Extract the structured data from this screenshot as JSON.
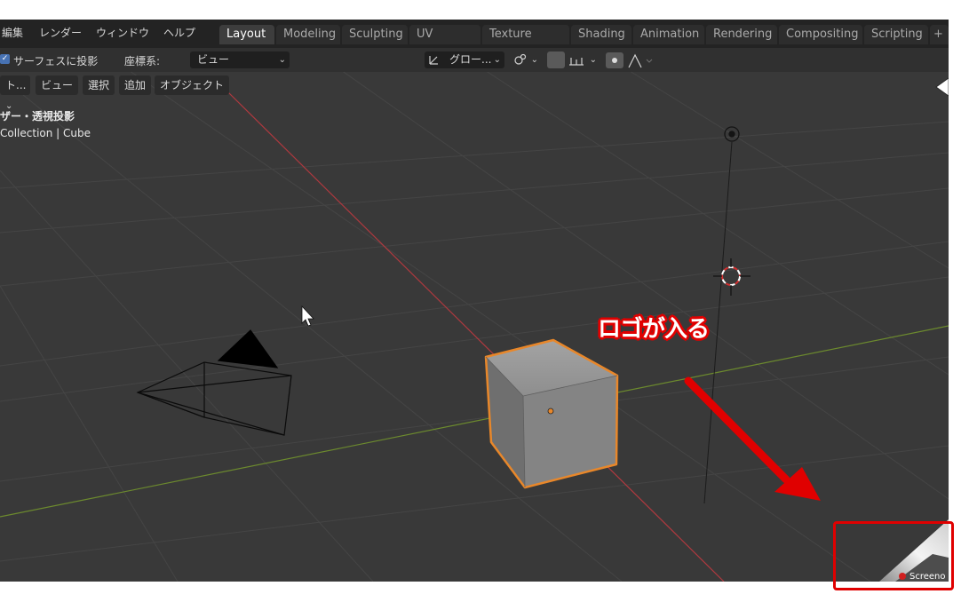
{
  "menu": {
    "edit": "編集",
    "render": "レンダー",
    "window": "ウィンドウ",
    "help": "ヘルプ"
  },
  "workspaces": [
    "Layout",
    "Modeling",
    "Sculpting",
    "UV Editing",
    "Texture Paint",
    "Shading",
    "Animation",
    "Rendering",
    "Compositing",
    "Scripting"
  ],
  "workspace_active": "Layout",
  "add_workspace": "+",
  "header": {
    "surface_project": "サーフェスに投影",
    "coordinate_label": "座標系:",
    "coordinate_value": "ビュー",
    "transform_orientation": "グロー...",
    "mode_truncated": "ト..."
  },
  "view_menu": {
    "view": "ビュー",
    "select": "選択",
    "add": "追加",
    "object": "オブジェクト"
  },
  "overlay": {
    "view_name": "ザー・透視投影",
    "collection": "Collection | Cube"
  },
  "callout": {
    "text": "ロゴが入る"
  },
  "watermark": {
    "text": "Screeno"
  },
  "colors": {
    "accent_red": "#e00000",
    "selection_orange": "#e8872a",
    "active_tab": "#3d3d3d",
    "viewport_bg": "#393939"
  },
  "icons": [
    "checkbox-checked-icon",
    "transform-icon",
    "snap-icon",
    "magnet-icon",
    "proportional-icon",
    "falloff-icon",
    "mouse-cursor-icon",
    "camera-icon",
    "light-icon",
    "3d-cursor-icon",
    "gizmo-icon"
  ]
}
